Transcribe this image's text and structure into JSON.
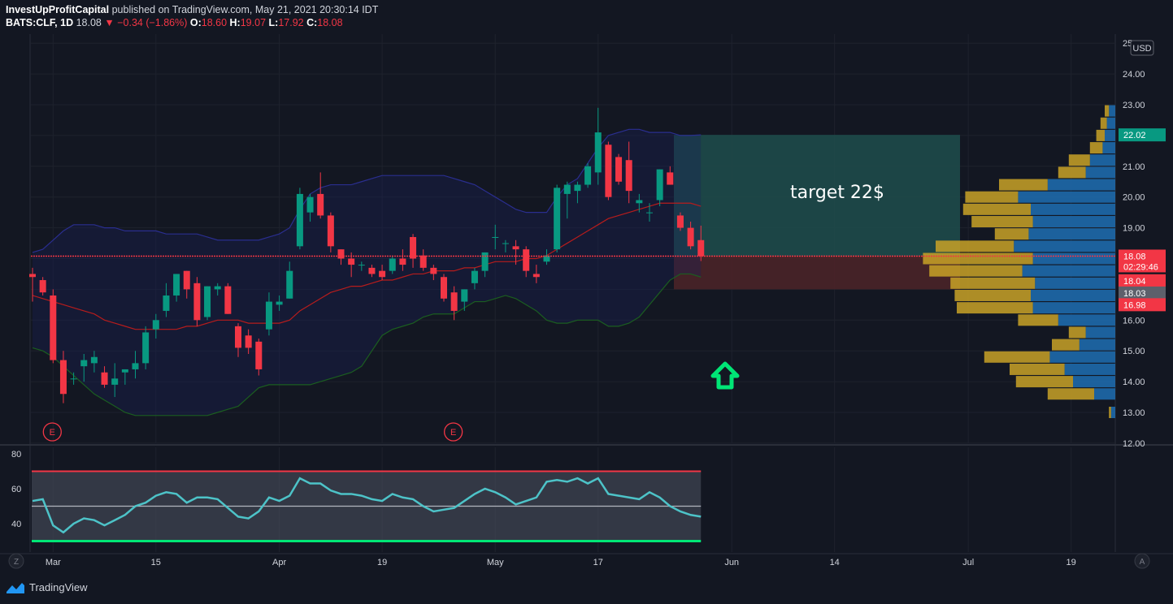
{
  "header": {
    "author": "InvestUpProfitCapital",
    "published": "published on TradingView.com, May 21, 2021 20:30:14 IDT",
    "symbol": "BATS:CLF, 1D",
    "last": "18.08",
    "arrow": "▼",
    "change": "−0.34 (−1.86%)",
    "o_label": "O:",
    "o": "18.60",
    "h_label": "H:",
    "h": "19.07",
    "l_label": "L:",
    "l": "17.92",
    "c_label": "C:",
    "c": "18.08"
  },
  "currency": "USD",
  "annotation": "target 22$",
  "earnings_marker": "E",
  "footer": {
    "brand": "TradingView"
  },
  "axis": {
    "z_button": "Z",
    "a_button": "A",
    "price_ticks": [
      "25.00",
      "24.00",
      "23.00",
      "22.00",
      "21.00",
      "20.00",
      "19.00",
      "18.00",
      "17.00",
      "16.00",
      "15.00",
      "14.00",
      "13.00",
      "12.00"
    ],
    "rsi_ticks": [
      "80",
      "60",
      "40"
    ],
    "time_ticks": [
      {
        "label": "Mar",
        "idx": 2
      },
      {
        "label": "15",
        "idx": 12
      },
      {
        "label": "Apr",
        "idx": 24
      },
      {
        "label": "19",
        "idx": 34
      },
      {
        "label": "May",
        "idx": 45
      },
      {
        "label": "17",
        "idx": 55
      },
      {
        "label": "Jun",
        "idx": 68
      },
      {
        "label": "14",
        "idx": 78
      },
      {
        "label": "Jul",
        "idx": 91
      },
      {
        "label": "19",
        "idx": 101
      }
    ],
    "price_badges": [
      {
        "text": "22.02",
        "value": 22.02,
        "color": "#089981"
      },
      {
        "text": "18.08",
        "value": 18.08,
        "color": "#f23645",
        "sub": "02:29:46"
      },
      {
        "text": "18.04",
        "value": 17.28,
        "color": "#f23645"
      },
      {
        "text": "18.03",
        "value": 16.88,
        "color": "#5d606b"
      },
      {
        "text": "16.98",
        "value": 16.5,
        "color": "#f23645"
      }
    ]
  },
  "colors": {
    "up": "#089981",
    "down": "#f23645",
    "bb_upper": "#2a2e8f",
    "bb_basis": "#b71c1c",
    "bb_lower": "#1b5e20",
    "rsi": "#4dc3c8",
    "target_zone": "#1e4a4a",
    "stop_zone": "#4a2328",
    "vp_up": "#1e6fb3",
    "vp_down": "#c9a227",
    "arrow": "#00e676"
  },
  "chart_data": [
    {
      "type": "candlestick",
      "title": "BATS:CLF, 1D",
      "currency": "USD",
      "ylim": [
        12,
        25
      ],
      "last_price": 18.08,
      "target_price": 22.02,
      "stop_price": 17.0,
      "candles": [
        [
          17.5,
          17.7,
          16.6,
          17.4
        ],
        [
          17.3,
          17.4,
          16.8,
          16.9
        ],
        [
          16.8,
          17.0,
          14.6,
          14.7
        ],
        [
          14.7,
          15.0,
          13.3,
          13.6
        ],
        [
          14.1,
          14.3,
          13.9,
          14.1
        ],
        [
          14.5,
          14.9,
          14.0,
          14.7
        ],
        [
          14.6,
          15.0,
          14.3,
          14.8
        ],
        [
          14.3,
          14.5,
          13.8,
          13.9
        ],
        [
          13.9,
          14.6,
          13.5,
          14.1
        ],
        [
          14.3,
          14.4,
          13.9,
          14.4
        ],
        [
          14.4,
          15.0,
          14.1,
          14.6
        ],
        [
          14.6,
          15.8,
          14.4,
          15.6
        ],
        [
          15.7,
          16.2,
          15.4,
          16.0
        ],
        [
          16.3,
          17.2,
          16.1,
          16.8
        ],
        [
          16.8,
          17.5,
          16.6,
          17.5
        ],
        [
          17.6,
          17.6,
          16.7,
          17.0
        ],
        [
          17.2,
          17.4,
          15.8,
          16.0
        ],
        [
          16.1,
          17.1,
          16.0,
          17.1
        ],
        [
          17.0,
          17.2,
          16.8,
          17.1
        ],
        [
          17.1,
          17.2,
          16.2,
          16.2
        ],
        [
          15.8,
          15.9,
          14.8,
          15.1
        ],
        [
          15.5,
          15.7,
          14.9,
          15.1
        ],
        [
          15.3,
          15.4,
          14.2,
          14.4
        ],
        [
          15.7,
          16.9,
          15.5,
          16.6
        ],
        [
          16.5,
          16.8,
          16.3,
          16.6
        ],
        [
          16.7,
          17.9,
          16.7,
          17.6
        ],
        [
          18.4,
          20.3,
          18.3,
          20.1
        ],
        [
          19.5,
          20.1,
          19.2,
          20.0
        ],
        [
          20.1,
          20.8,
          19.3,
          19.4
        ],
        [
          19.4,
          19.5,
          18.2,
          18.4
        ],
        [
          18.3,
          18.3,
          17.8,
          18.0
        ],
        [
          18.0,
          18.2,
          17.4,
          17.8
        ],
        [
          17.8,
          17.9,
          17.6,
          17.8
        ],
        [
          17.7,
          17.8,
          17.4,
          17.5
        ],
        [
          17.6,
          17.8,
          17.3,
          17.4
        ],
        [
          17.6,
          18.1,
          17.5,
          18.0
        ],
        [
          18.0,
          18.3,
          17.6,
          17.8
        ],
        [
          18.7,
          18.8,
          17.7,
          18.0
        ],
        [
          18.1,
          18.3,
          17.6,
          17.7
        ],
        [
          17.7,
          17.8,
          17.3,
          17.5
        ],
        [
          17.4,
          17.5,
          16.6,
          16.7
        ],
        [
          16.9,
          17.1,
          16.0,
          16.3
        ],
        [
          16.6,
          17.0,
          16.3,
          17.0
        ],
        [
          17.2,
          17.7,
          17.0,
          17.6
        ],
        [
          17.6,
          18.2,
          17.4,
          18.2
        ],
        [
          18.7,
          19.1,
          18.3,
          18.7
        ],
        [
          18.5,
          18.6,
          18.2,
          18.5
        ],
        [
          18.4,
          18.6,
          17.8,
          18.3
        ],
        [
          18.3,
          18.4,
          17.4,
          17.6
        ],
        [
          17.5,
          17.8,
          17.2,
          17.4
        ],
        [
          17.9,
          18.3,
          17.8,
          18.1
        ],
        [
          18.3,
          20.4,
          18.2,
          20.3
        ],
        [
          20.1,
          20.5,
          19.3,
          20.4
        ],
        [
          20.2,
          20.5,
          19.8,
          20.4
        ],
        [
          20.4,
          21.1,
          20.3,
          21.0
        ],
        [
          20.8,
          22.9,
          20.4,
          22.1
        ],
        [
          21.7,
          21.8,
          19.9,
          20.0
        ],
        [
          21.3,
          21.4,
          20.4,
          20.5
        ],
        [
          21.2,
          21.8,
          19.8,
          20.2
        ],
        [
          19.8,
          20.1,
          19.5,
          19.9
        ],
        [
          19.5,
          19.8,
          19.2,
          19.5
        ],
        [
          19.9,
          20.9,
          19.7,
          20.9
        ],
        [
          20.8,
          21.0,
          20.4,
          20.4
        ],
        [
          19.4,
          19.5,
          18.9,
          19.0
        ],
        [
          19.0,
          19.2,
          18.3,
          18.4
        ],
        [
          18.6,
          19.07,
          17.92,
          18.08
        ]
      ],
      "bollinger": {
        "upper": [
          18.2,
          18.3,
          18.6,
          18.9,
          19.1,
          19.1,
          19.1,
          19.0,
          19.0,
          18.9,
          18.9,
          18.9,
          18.9,
          18.8,
          18.8,
          18.8,
          18.8,
          18.7,
          18.6,
          18.6,
          18.6,
          18.6,
          18.6,
          18.7,
          18.8,
          19.0,
          19.6,
          20.1,
          20.3,
          20.4,
          20.4,
          20.4,
          20.5,
          20.6,
          20.7,
          20.7,
          20.7,
          20.7,
          20.7,
          20.7,
          20.7,
          20.6,
          20.5,
          20.4,
          20.2,
          20.0,
          19.8,
          19.6,
          19.5,
          19.5,
          19.5,
          20.0,
          20.4,
          20.6,
          21.1,
          21.6,
          22.0,
          22.1,
          22.2,
          22.2,
          22.1,
          22.1,
          22.1,
          22.0,
          22.0,
          22.02
        ],
        "basis": [
          16.8,
          16.7,
          16.6,
          16.5,
          16.4,
          16.3,
          16.2,
          16.0,
          15.9,
          15.8,
          15.7,
          15.7,
          15.7,
          15.7,
          15.7,
          15.8,
          15.8,
          15.9,
          16.0,
          16.0,
          16.0,
          15.9,
          15.9,
          15.9,
          15.9,
          16.0,
          16.3,
          16.5,
          16.7,
          16.9,
          17.0,
          17.1,
          17.1,
          17.2,
          17.3,
          17.3,
          17.4,
          17.5,
          17.5,
          17.6,
          17.6,
          17.6,
          17.7,
          17.7,
          17.8,
          17.9,
          17.9,
          17.9,
          18.0,
          18.0,
          18.1,
          18.3,
          18.5,
          18.7,
          18.9,
          19.1,
          19.3,
          19.4,
          19.5,
          19.6,
          19.7,
          19.8,
          19.8,
          19.8,
          19.8,
          19.7
        ],
        "lower": [
          15.1,
          15.0,
          14.8,
          14.5,
          14.2,
          13.9,
          13.6,
          13.4,
          13.2,
          13.0,
          12.9,
          12.9,
          12.9,
          12.9,
          12.9,
          12.9,
          12.9,
          12.9,
          13.0,
          13.1,
          13.2,
          13.5,
          13.8,
          13.9,
          13.9,
          13.9,
          13.9,
          13.9,
          14.0,
          14.1,
          14.2,
          14.3,
          14.5,
          15.0,
          15.5,
          15.7,
          15.8,
          15.9,
          16.1,
          16.2,
          16.2,
          16.2,
          16.4,
          16.6,
          16.6,
          16.7,
          16.8,
          16.7,
          16.5,
          16.3,
          16.0,
          15.9,
          15.9,
          16.0,
          16.0,
          16.0,
          15.8,
          15.8,
          15.9,
          16.1,
          16.5,
          16.9,
          17.3,
          17.5,
          17.5,
          17.4
        ]
      },
      "volume_profile": [
        {
          "price": 22.8,
          "up": 0.3,
          "down": 0.2
        },
        {
          "price": 22.4,
          "up": 0.4,
          "down": 0.3
        },
        {
          "price": 22.0,
          "up": 0.5,
          "down": 0.4
        },
        {
          "price": 21.6,
          "up": 0.6,
          "down": 0.6
        },
        {
          "price": 21.2,
          "up": 1.2,
          "down": 1.0
        },
        {
          "price": 20.8,
          "up": 1.4,
          "down": 1.3
        },
        {
          "price": 20.4,
          "up": 3.2,
          "down": 2.3
        },
        {
          "price": 20.0,
          "up": 4.6,
          "down": 2.5
        },
        {
          "price": 19.6,
          "up": 4.0,
          "down": 3.2
        },
        {
          "price": 19.2,
          "up": 3.9,
          "down": 2.9
        },
        {
          "price": 18.8,
          "up": 4.1,
          "down": 1.6
        },
        {
          "price": 18.4,
          "up": 4.8,
          "down": 3.7
        },
        {
          "price": 18.0,
          "up": 3.9,
          "down": 5.2
        },
        {
          "price": 17.6,
          "up": 4.4,
          "down": 4.4
        },
        {
          "price": 17.2,
          "up": 3.8,
          "down": 4.0
        },
        {
          "price": 16.8,
          "up": 4.0,
          "down": 3.6
        },
        {
          "price": 16.4,
          "up": 3.9,
          "down": 3.6
        },
        {
          "price": 16.0,
          "up": 2.7,
          "down": 1.9
        },
        {
          "price": 15.6,
          "up": 1.4,
          "down": 0.8
        },
        {
          "price": 15.2,
          "up": 1.7,
          "down": 1.3
        },
        {
          "price": 14.8,
          "up": 3.1,
          "down": 3.1
        },
        {
          "price": 14.4,
          "up": 2.4,
          "down": 2.6
        },
        {
          "price": 14.0,
          "up": 2.0,
          "down": 2.7
        },
        {
          "price": 13.6,
          "up": 1.0,
          "down": 2.2
        },
        {
          "price": 13.0,
          "up": 0.2,
          "down": 0.1
        }
      ]
    },
    {
      "type": "line",
      "title": "RSI",
      "ylim": [
        25,
        80
      ],
      "upper_band": 70,
      "middle": 50,
      "lower_band": 30,
      "values": [
        53,
        54,
        39,
        35,
        40,
        43,
        42,
        39,
        42,
        45,
        50,
        52,
        56,
        58,
        57,
        52,
        55,
        55,
        54,
        49,
        44,
        43,
        47,
        55,
        53,
        56,
        66,
        63,
        63,
        59,
        57,
        57,
        56,
        54,
        53,
        57,
        55,
        54,
        50,
        47,
        48,
        49,
        53,
        57,
        60,
        58,
        55,
        51,
        53,
        55,
        64,
        65,
        64,
        66,
        63,
        66,
        57,
        56,
        55,
        54,
        58,
        55,
        50,
        47,
        45,
        44
      ]
    }
  ]
}
